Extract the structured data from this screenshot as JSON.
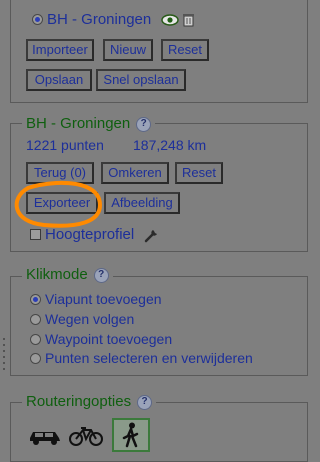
{
  "top_panel": {
    "route_name": "BH - Groningen",
    "buttons": {
      "import": "Importeer",
      "new": "Nieuw",
      "reset": "Reset",
      "save": "Opslaan",
      "quick_save": "Snel opslaan"
    }
  },
  "route_panel": {
    "title": "BH - Groningen",
    "points": "1221 punten",
    "distance": "187,248 km",
    "buttons": {
      "back": "Terug (0)",
      "reverse": "Omkeren",
      "reset": "Reset",
      "export": "Exporteer",
      "image": "Afbeelding"
    },
    "height_profile_label": "Hoogteprofiel"
  },
  "click_mode": {
    "title": "Klikmode",
    "options": [
      {
        "label": "Viapunt toevoegen",
        "checked": true
      },
      {
        "label": "Wegen volgen",
        "checked": false
      },
      {
        "label": "Waypoint toevoegen",
        "checked": false
      },
      {
        "label": "Punten selecteren en verwijderen",
        "checked": false
      }
    ]
  },
  "routing": {
    "title": "Routeringopties",
    "modes": [
      "car-icon",
      "bicycle-icon",
      "walking-icon"
    ],
    "selected": "walking-icon"
  },
  "colors": {
    "annotation": "#ff8a00",
    "accent_text": "#1d2f9a",
    "legend_text": "#0f5f0f"
  }
}
